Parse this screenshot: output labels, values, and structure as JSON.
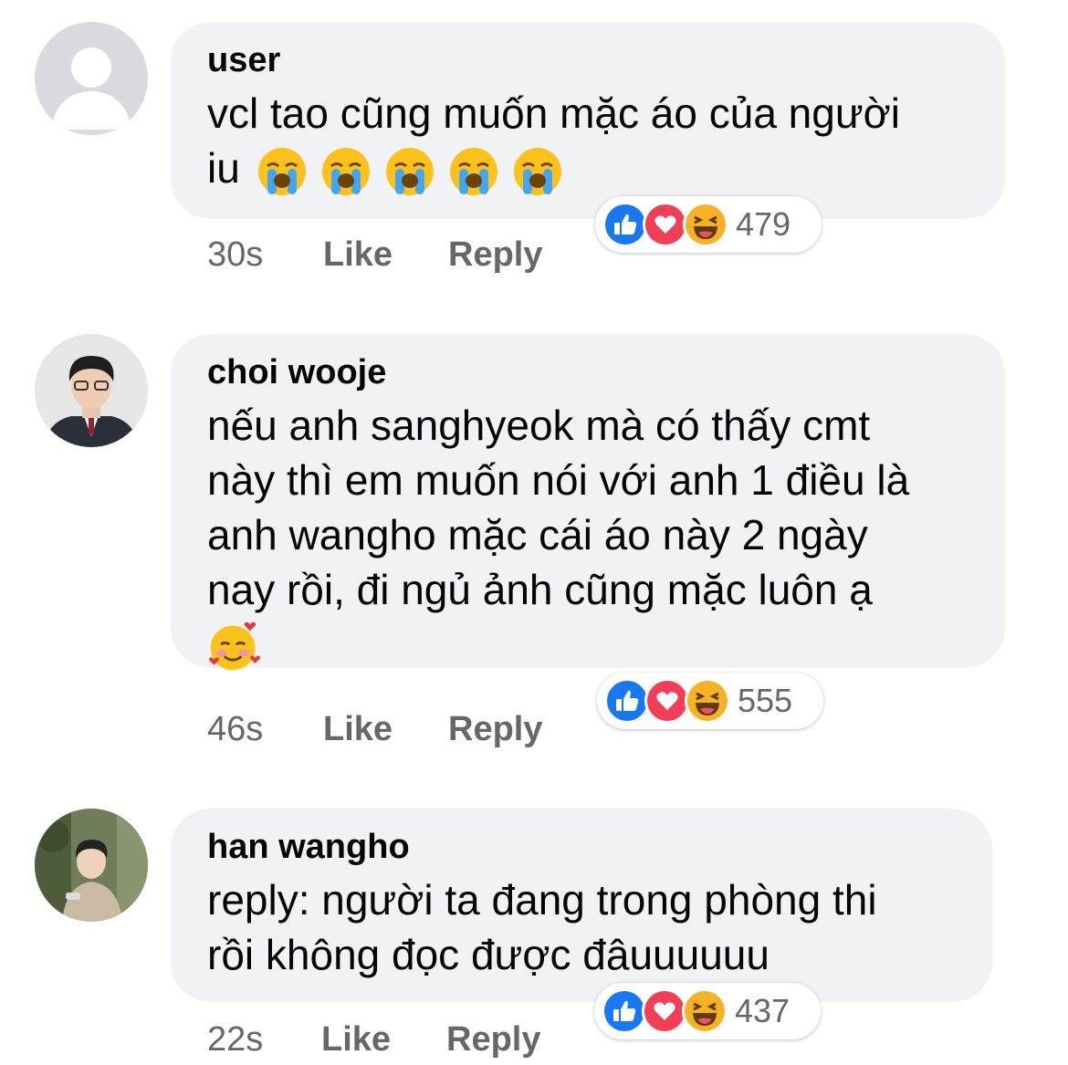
{
  "comments": [
    {
      "author": "user",
      "lines": [
        "vcl tao cũng muốn mặc áo của người",
        "iu"
      ],
      "emoji_after_last_line": {
        "name": "loudly-crying-face-emoji",
        "count": 5
      },
      "time": "30s",
      "like_label": "Like",
      "reply_label": "Reply",
      "reactions": {
        "icons": [
          "like-icon",
          "love-icon",
          "haha-icon"
        ],
        "count": "479"
      }
    },
    {
      "author": "choi wooje",
      "lines": [
        "nếu anh sanghyeok mà có thấy cmt",
        "này thì em muốn nói với anh 1 điều là",
        "anh wangho mặc cái áo này 2 ngày",
        "nay rồi, đi ngủ ảnh cũng mặc luôn ạ"
      ],
      "emoji_line": {
        "name": "smiling-face-with-hearts-emoji",
        "count": 1
      },
      "time": "46s",
      "like_label": "Like",
      "reply_label": "Reply",
      "reactions": {
        "icons": [
          "like-icon",
          "love-icon",
          "haha-icon"
        ],
        "count": "555"
      }
    },
    {
      "author": "han wangho",
      "lines": [
        "reply: người ta đang trong phòng thi",
        "rồi không đọc được đâuuuuuu"
      ],
      "time": "22s",
      "like_label": "Like",
      "reply_label": "Reply",
      "reactions": {
        "icons": [
          "like-icon",
          "love-icon",
          "haha-icon"
        ],
        "count": "437"
      }
    }
  ],
  "colors": {
    "bubble_bg": "#f0f2f5",
    "meta_text": "#65676b",
    "like_blue": "#1877f2",
    "love_red": "#f33e58",
    "haha_yellow": "#f7b125"
  }
}
